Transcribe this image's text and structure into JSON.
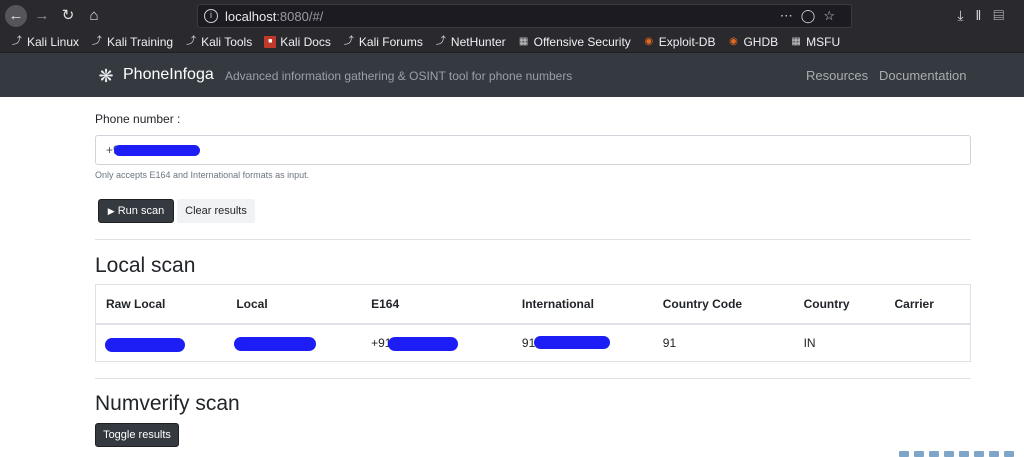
{
  "browser": {
    "url_host": "localhost",
    "url_rest": ":8080/#/",
    "bookmarks": [
      {
        "label": "Kali Linux",
        "icon": "kali-dragon-icon"
      },
      {
        "label": "Kali Training",
        "icon": "kali-dragon-icon"
      },
      {
        "label": "Kali Tools",
        "icon": "kali-dragon-icon"
      },
      {
        "label": "Kali Docs",
        "icon": "kali-docs-icon"
      },
      {
        "label": "Kali Forums",
        "icon": "kali-dragon-icon"
      },
      {
        "label": "NetHunter",
        "icon": "kali-dragon-icon"
      },
      {
        "label": "Offensive Security",
        "icon": "offsec-icon"
      },
      {
        "label": "Exploit-DB",
        "icon": "exploitdb-icon"
      },
      {
        "label": "GHDB",
        "icon": "exploitdb-icon"
      },
      {
        "label": "MSFU",
        "icon": "offsec-icon"
      }
    ]
  },
  "app": {
    "brand": "PhoneInfoga",
    "tagline": "Advanced information gathering & OSINT tool for phone numbers",
    "nav": {
      "resources": "Resources",
      "documentation": "Documentation"
    }
  },
  "form": {
    "label": "Phone number :",
    "value_prefix": "+9",
    "help": "Only accepts E164 and International formats as input.",
    "run_label": "Run scan",
    "clear_label": "Clear results"
  },
  "local_scan": {
    "title": "Local scan",
    "columns": [
      "Raw Local",
      "Local",
      "E164",
      "International",
      "Country Code",
      "Country",
      "Carrier"
    ],
    "row": {
      "raw_local": "",
      "local": "",
      "e164": "+91",
      "international": "91",
      "country_code": "91",
      "country": "IN",
      "carrier": ""
    }
  },
  "numverify": {
    "title": "Numverify scan",
    "toggle_label": "Toggle results"
  },
  "colors": {
    "navbar": "#343a40",
    "browser_chrome": "#2a2a2e",
    "redaction": "#1d1df5"
  }
}
